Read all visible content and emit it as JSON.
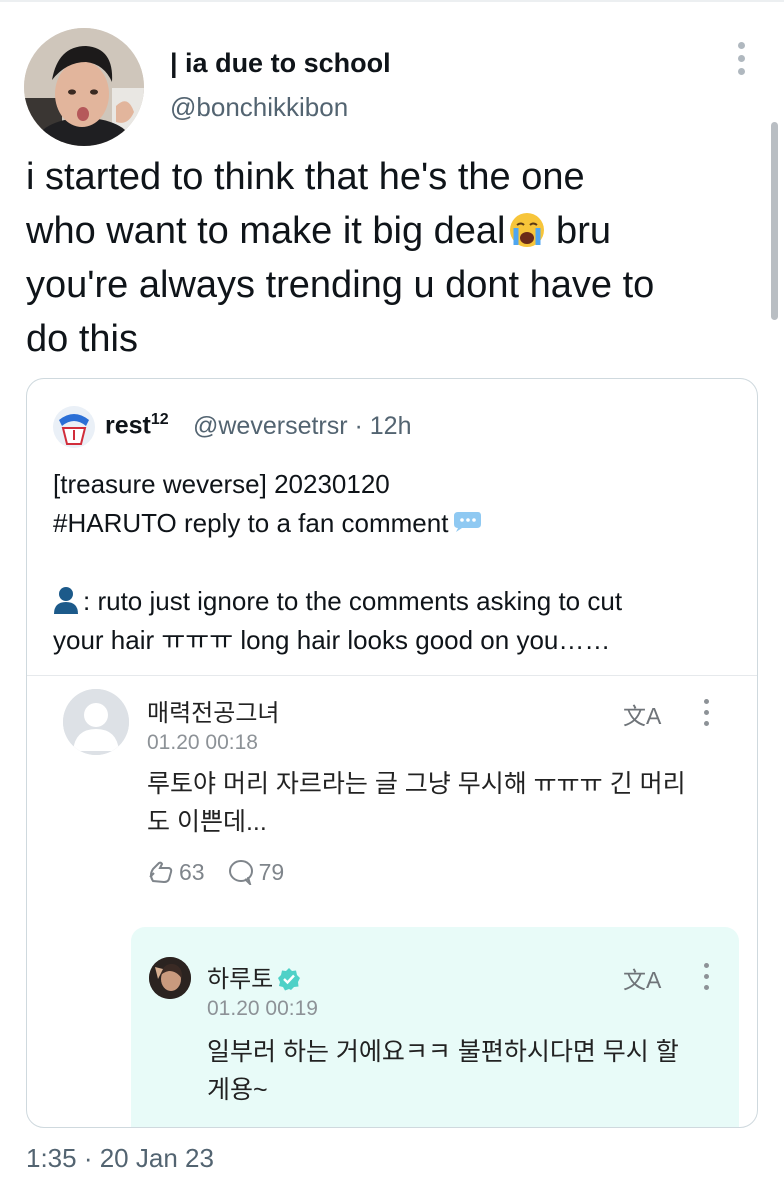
{
  "tweet": {
    "display_name": "| ia due to school",
    "handle": "@bonchikkibon",
    "text_lines": [
      "i started to think that he's the one",
      "who want to make it big deal",
      " bru",
      "you're always trending u dont have to",
      "do this"
    ],
    "timestamp": "1:35 · 20 Jan 23"
  },
  "quoted": {
    "name": "rest",
    "name_sup": "12",
    "handle_time": "@weversetrsr · 12h",
    "lines": [
      "[treasure weverse] 20230120",
      "#HARUTO reply to a fan comment",
      "",
      ": ruto just ignore to the comments asking to cut",
      "your hair ㅠㅠㅠ long hair looks good on you……"
    ],
    "comment": {
      "author": "매력전공그녀",
      "time": "01.20 00:18",
      "body": "루토야 머리 자르라는 글 그냥 무시해 ㅠㅠㅠ 긴 머리도 이쁜데...",
      "translate": "文A",
      "likes": "63",
      "replies": "79"
    },
    "reply": {
      "author": "하루토",
      "time": "01.20 00:19",
      "body": "일부러 하는 거에요ㅋㅋ 불편하시다면 무시 할 게용~",
      "translate": "文A",
      "accent": "#4fd1c7"
    }
  },
  "colors": {
    "text": "#0f1419",
    "secondary": "#536471",
    "reply_bg": "#e8fbf8"
  }
}
